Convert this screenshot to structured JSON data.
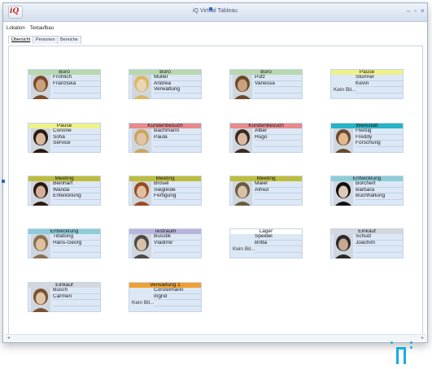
{
  "window": {
    "title": "iQ Virtual Tableau",
    "logo_text": "iQ",
    "controls": [
      "–",
      "▫",
      "×"
    ]
  },
  "menu": [
    "Lokation",
    "Textaufbau"
  ],
  "tabs": [
    {
      "label": "Übersicht",
      "active": true
    },
    {
      "label": "Personen",
      "active": false
    },
    {
      "label": "Bereiche",
      "active": false
    }
  ],
  "no_photo_label": "Kein Bil...",
  "colors": {
    "Büro": "#b8d8b0",
    "Pause": "#eef28a",
    "Kundenbesuch": "#e88a8a",
    "Werkstatt": "#26b3c4",
    "Meeting": "#bdbd3a",
    "Entwicklung": "#8ccdd8",
    "Testraum": "#b8b4dc",
    "Lager": "#ffffff",
    "Einkauf": "#d4d8de",
    "Verwaltung 1": "#f0a030"
  },
  "cards": [
    {
      "location": "Büro",
      "names": [
        "Fröhlich",
        "Franziska",
        ""
      ],
      "photo": "woman-brown-hair",
      "has_photo": true
    },
    {
      "location": "Büro",
      "names": [
        "Müller",
        "Andrea",
        "Verwaltung"
      ],
      "photo": "woman-blonde",
      "has_photo": true
    },
    {
      "location": "Büro",
      "names": [
        "Putz",
        "Vanessa",
        ""
      ],
      "photo": "woman-long-hair",
      "has_photo": true
    },
    {
      "location": "Pause",
      "names": [
        "Stürmer",
        "Kevin",
        ""
      ],
      "photo": "",
      "has_photo": false
    },
    {
      "location": "Pause",
      "names": [
        "Conone",
        "Sofia",
        "Service"
      ],
      "photo": "woman-dark-hair",
      "has_photo": true
    },
    {
      "location": "Kundenbesuch",
      "names": [
        "Bachmann",
        "Paula",
        ""
      ],
      "photo": "woman-blonde-curly",
      "has_photo": true
    },
    {
      "location": "Kundenbesuch",
      "names": [
        "Alber",
        "Hugo",
        ""
      ],
      "photo": "man-suit",
      "has_photo": true
    },
    {
      "location": "Werkstatt",
      "names": [
        "Fleißig",
        "Freddy",
        "Forschung"
      ],
      "photo": "man-smiling",
      "has_photo": true
    },
    {
      "location": "Meeting",
      "names": [
        "Beinhart",
        "Wanda",
        "Entwicklung"
      ],
      "photo": "woman-dark-long",
      "has_photo": true
    },
    {
      "location": "Meeting",
      "names": [
        "Brösel",
        "Sieglinde",
        "Fertigung"
      ],
      "photo": "woman-red-hair",
      "has_photo": true
    },
    {
      "location": "Meeting",
      "names": [
        "Maier",
        "Alfred",
        ""
      ],
      "photo": "man-office",
      "has_photo": true
    },
    {
      "location": "Entwicklung",
      "names": [
        "Borchert",
        "Barbara",
        "Buchhaltung"
      ],
      "photo": "woman-black-hair",
      "has_photo": true
    },
    {
      "location": "Entwicklung",
      "names": [
        "Tibatong",
        "Hans-Georg",
        ""
      ],
      "photo": "man-beard",
      "has_photo": true
    },
    {
      "location": "Testraum",
      "names": [
        "Busstik",
        "Vladimir",
        ""
      ],
      "photo": "man-glasses",
      "has_photo": true
    },
    {
      "location": "Lager",
      "names": [
        "Speidel",
        "Britta",
        ""
      ],
      "photo": "",
      "has_photo": false
    },
    {
      "location": "Einkauf",
      "names": [
        "Schulz",
        "Joachim",
        ""
      ],
      "photo": "man-dark",
      "has_photo": true
    },
    {
      "location": "Einkauf",
      "names": [
        "Busch",
        "Carmen",
        ""
      ],
      "photo": "woman-smiling",
      "has_photo": true
    },
    {
      "location": "Verwaltung 1",
      "names": [
        "Conzelmann",
        "Ingrid",
        ""
      ],
      "photo": "",
      "has_photo": false
    }
  ]
}
